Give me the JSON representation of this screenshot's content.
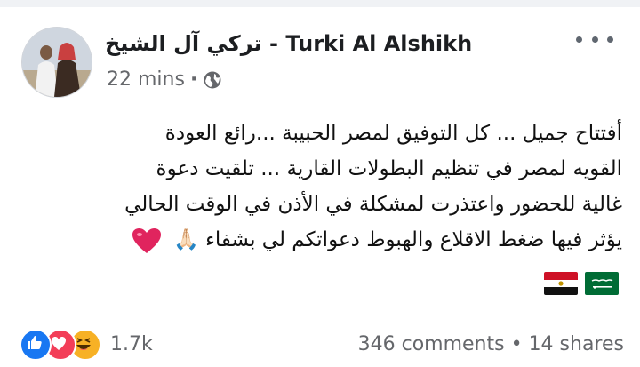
{
  "post": {
    "author_name": "تركي آل الشيخ - Turki Al Alshikh",
    "timestamp": "22 mins",
    "privacy_icon": "globe-icon",
    "body_lines": [
      "أفتتاح جميل ... كل التوفيق لمصر الحبيبة ...رائع العودة",
      "القويه لمصر في تنظيم البطولات القارية ... تلقيت دعوة",
      "غالية للحضور واعتذرت لمشكلة في الأذن في الوقت الحالي",
      "يؤثر فيها ضغط الاقلاع والهبوط دعواتكم لي بشفاء"
    ],
    "emojis": [
      "🙏🏻",
      "❤️"
    ],
    "flags": [
      "egypt-flag",
      "saudi-arabia-flag"
    ]
  },
  "engagement": {
    "reactions": [
      "like",
      "love",
      "haha"
    ],
    "reaction_count": "1.7k",
    "comments": "346 comments",
    "separator": "•",
    "shares": "14 shares"
  },
  "colors": {
    "like": "#1877f2",
    "love": "#f33e58",
    "haha": "#f7b125",
    "meta_gray": "#65676b"
  }
}
